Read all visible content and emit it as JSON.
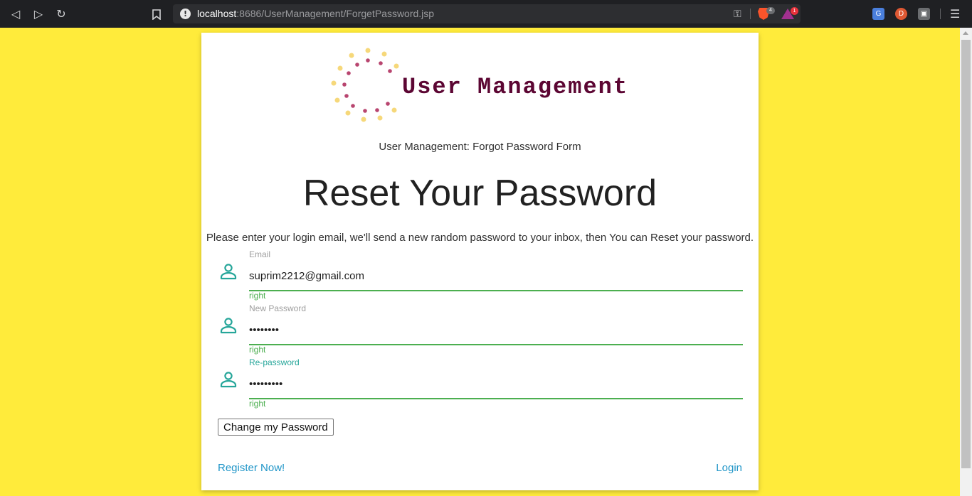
{
  "browser": {
    "url_host": "localhost",
    "url_rest": ":8686/UserManagement/ForgetPassword.jsp",
    "brave_shield_count": "4",
    "rewards_badge_count": "1"
  },
  "header": {
    "logo_title": "User Management",
    "subtitle": "User Management: Forgot Password Form"
  },
  "main": {
    "heading": "Reset Your Password",
    "instructions": "Please enter your login email, we'll send a new random password to your inbox, then You can Reset your password."
  },
  "form": {
    "email": {
      "label": "Email",
      "value": "suprim2212@gmail.com",
      "helper": "right"
    },
    "new_password": {
      "label": "New Password",
      "value": "••••••••",
      "helper": "right"
    },
    "re_password": {
      "label": "Re-password",
      "value": "•••••••••",
      "helper": "right"
    },
    "submit_label": "Change my Password"
  },
  "footer": {
    "register_label": "Register Now!",
    "login_label": "Login"
  },
  "colors": {
    "page_background": "#ffeb3b",
    "logo_text": "#5c0633",
    "accent_green": "#4caf50",
    "icon_teal": "#26a69a",
    "link_blue": "#2196c8"
  }
}
